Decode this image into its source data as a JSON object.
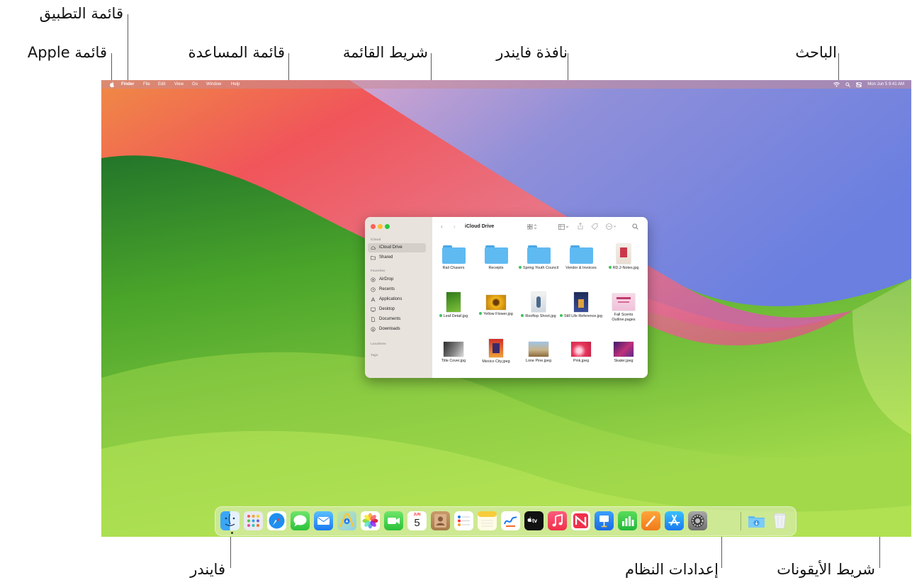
{
  "callouts": {
    "app_menu": "قائمة التطبيق",
    "apple_menu": "قائمة Apple",
    "help_menu": "قائمة المساعدة",
    "menu_bar": "شريط القائمة",
    "finder_window": "نافذة فايندر",
    "spotlight": "الباحث",
    "finder": "فايندر",
    "system_settings": "إعدادات النظام",
    "dock": "شريط الأيقونات"
  },
  "menubar": {
    "app_name": "Finder",
    "menus": [
      "File",
      "Edit",
      "View",
      "Go",
      "Window",
      "Help"
    ],
    "clock": "Mon Jun 5  9:41 AM",
    "status_icons": [
      "wifi-icon",
      "search-icon",
      "control-center-icon"
    ]
  },
  "finder_window": {
    "title": "iCloud Drive",
    "sidebar": {
      "section_icloud": "iCloud",
      "icloud_items": [
        "iCloud Drive",
        "Shared"
      ],
      "section_favorites": "Favorites",
      "favorite_items": [
        "AirDrop",
        "Recents",
        "Applications",
        "Desktop",
        "Documents",
        "Downloads"
      ],
      "section_locations": "Locations",
      "section_tags": "Tags",
      "selected": "iCloud Drive"
    },
    "items": [
      {
        "name": "Rail Chasers",
        "kind": "folder",
        "tag": false
      },
      {
        "name": "Receipts",
        "kind": "folder",
        "tag": false
      },
      {
        "name": "Spring Youth Council",
        "kind": "folder",
        "tag": true
      },
      {
        "name": "Vendor & Invoices",
        "kind": "folder",
        "tag": false
      },
      {
        "name": "RD.2-Notes.jpg",
        "kind": "image",
        "tag": true
      },
      {
        "name": "Leaf Detail.jpg",
        "kind": "image",
        "tag": true
      },
      {
        "name": "Yellow Flower.jpg",
        "kind": "image",
        "tag": true
      },
      {
        "name": "Rooftop Shoot.jpg",
        "kind": "image",
        "tag": true
      },
      {
        "name": "Still Life Reference.jpg",
        "kind": "image",
        "tag": true
      },
      {
        "name": "Fall Scents Outline.pages",
        "kind": "document",
        "tag": false
      },
      {
        "name": "Title Cover.jpg",
        "kind": "image",
        "tag": false
      },
      {
        "name": "Mexico City.jpeg",
        "kind": "image",
        "tag": false
      },
      {
        "name": "Lone Pine.jpeg",
        "kind": "image",
        "tag": false
      },
      {
        "name": "Pink.jpeg",
        "kind": "image",
        "tag": false
      },
      {
        "name": "Skater.jpeg",
        "kind": "image",
        "tag": false
      }
    ]
  },
  "dock": {
    "calendar_month": "JUN",
    "calendar_day": "5",
    "tv_label": "tv",
    "apps": [
      "Finder",
      "Launchpad",
      "Safari",
      "Messages",
      "Mail",
      "Maps",
      "Photos",
      "FaceTime",
      "Calendar",
      "Contacts",
      "Reminders",
      "Notes",
      "Freeform",
      "TV",
      "Music",
      "News",
      "Keynote",
      "Numbers",
      "Pages",
      "App Store",
      "System Settings",
      "Downloads",
      "Trash"
    ]
  },
  "colors": {
    "finder_blue": "#1e8cf0",
    "tag_green": "#3cc35a",
    "folder_blue": "#5fbaf2"
  }
}
